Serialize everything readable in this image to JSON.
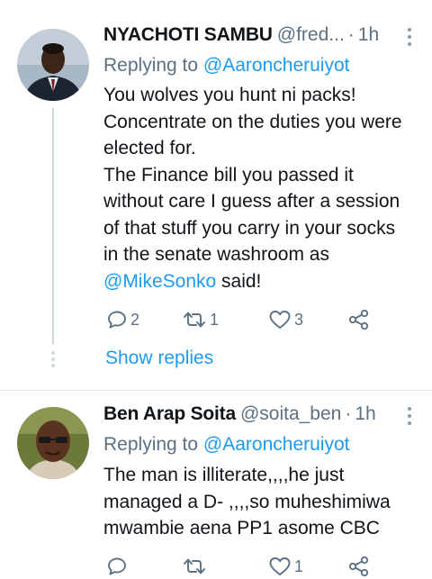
{
  "tweets": [
    {
      "name": "NYACHOTI SAMBU",
      "handle": "@fred...",
      "separator": "·",
      "time": "1h",
      "reply_prefix": "Replying to",
      "reply_to": "@Aaroncheruiyot",
      "lines": [
        "You wolves you hunt ni packs!",
        "Concentrate on the duties you were",
        "elected for.",
        "The Finance bill you passed it",
        "without care I guess after a session",
        "of that stuff you carry in your socks",
        "in the senate washroom as"
      ],
      "last_line_mention": "@MikeSonko",
      "last_line_rest": " said!",
      "replies": "2",
      "retweets": "1",
      "likes": "3",
      "show_replies": "Show replies"
    },
    {
      "name": "Ben Arap Soita",
      "handle": "@soita_ben",
      "separator": "·",
      "time": "1h",
      "reply_prefix": "Replying to",
      "reply_to": "@Aaroncheruiyot",
      "lines": [
        "The man is illiterate,,,,he just",
        "managed a D- ,,,,so muheshimiwa",
        "mwambie aena PP1 asome CBC"
      ],
      "replies": "",
      "retweets": "",
      "likes": "1"
    }
  ],
  "colors": {
    "link": "#1d9bf0",
    "secondary_text": "#5b7083",
    "icon": "#5b7083"
  },
  "icons": [
    "more-vertical-icon",
    "reply-icon",
    "retweet-icon",
    "like-icon",
    "share-icon"
  ]
}
